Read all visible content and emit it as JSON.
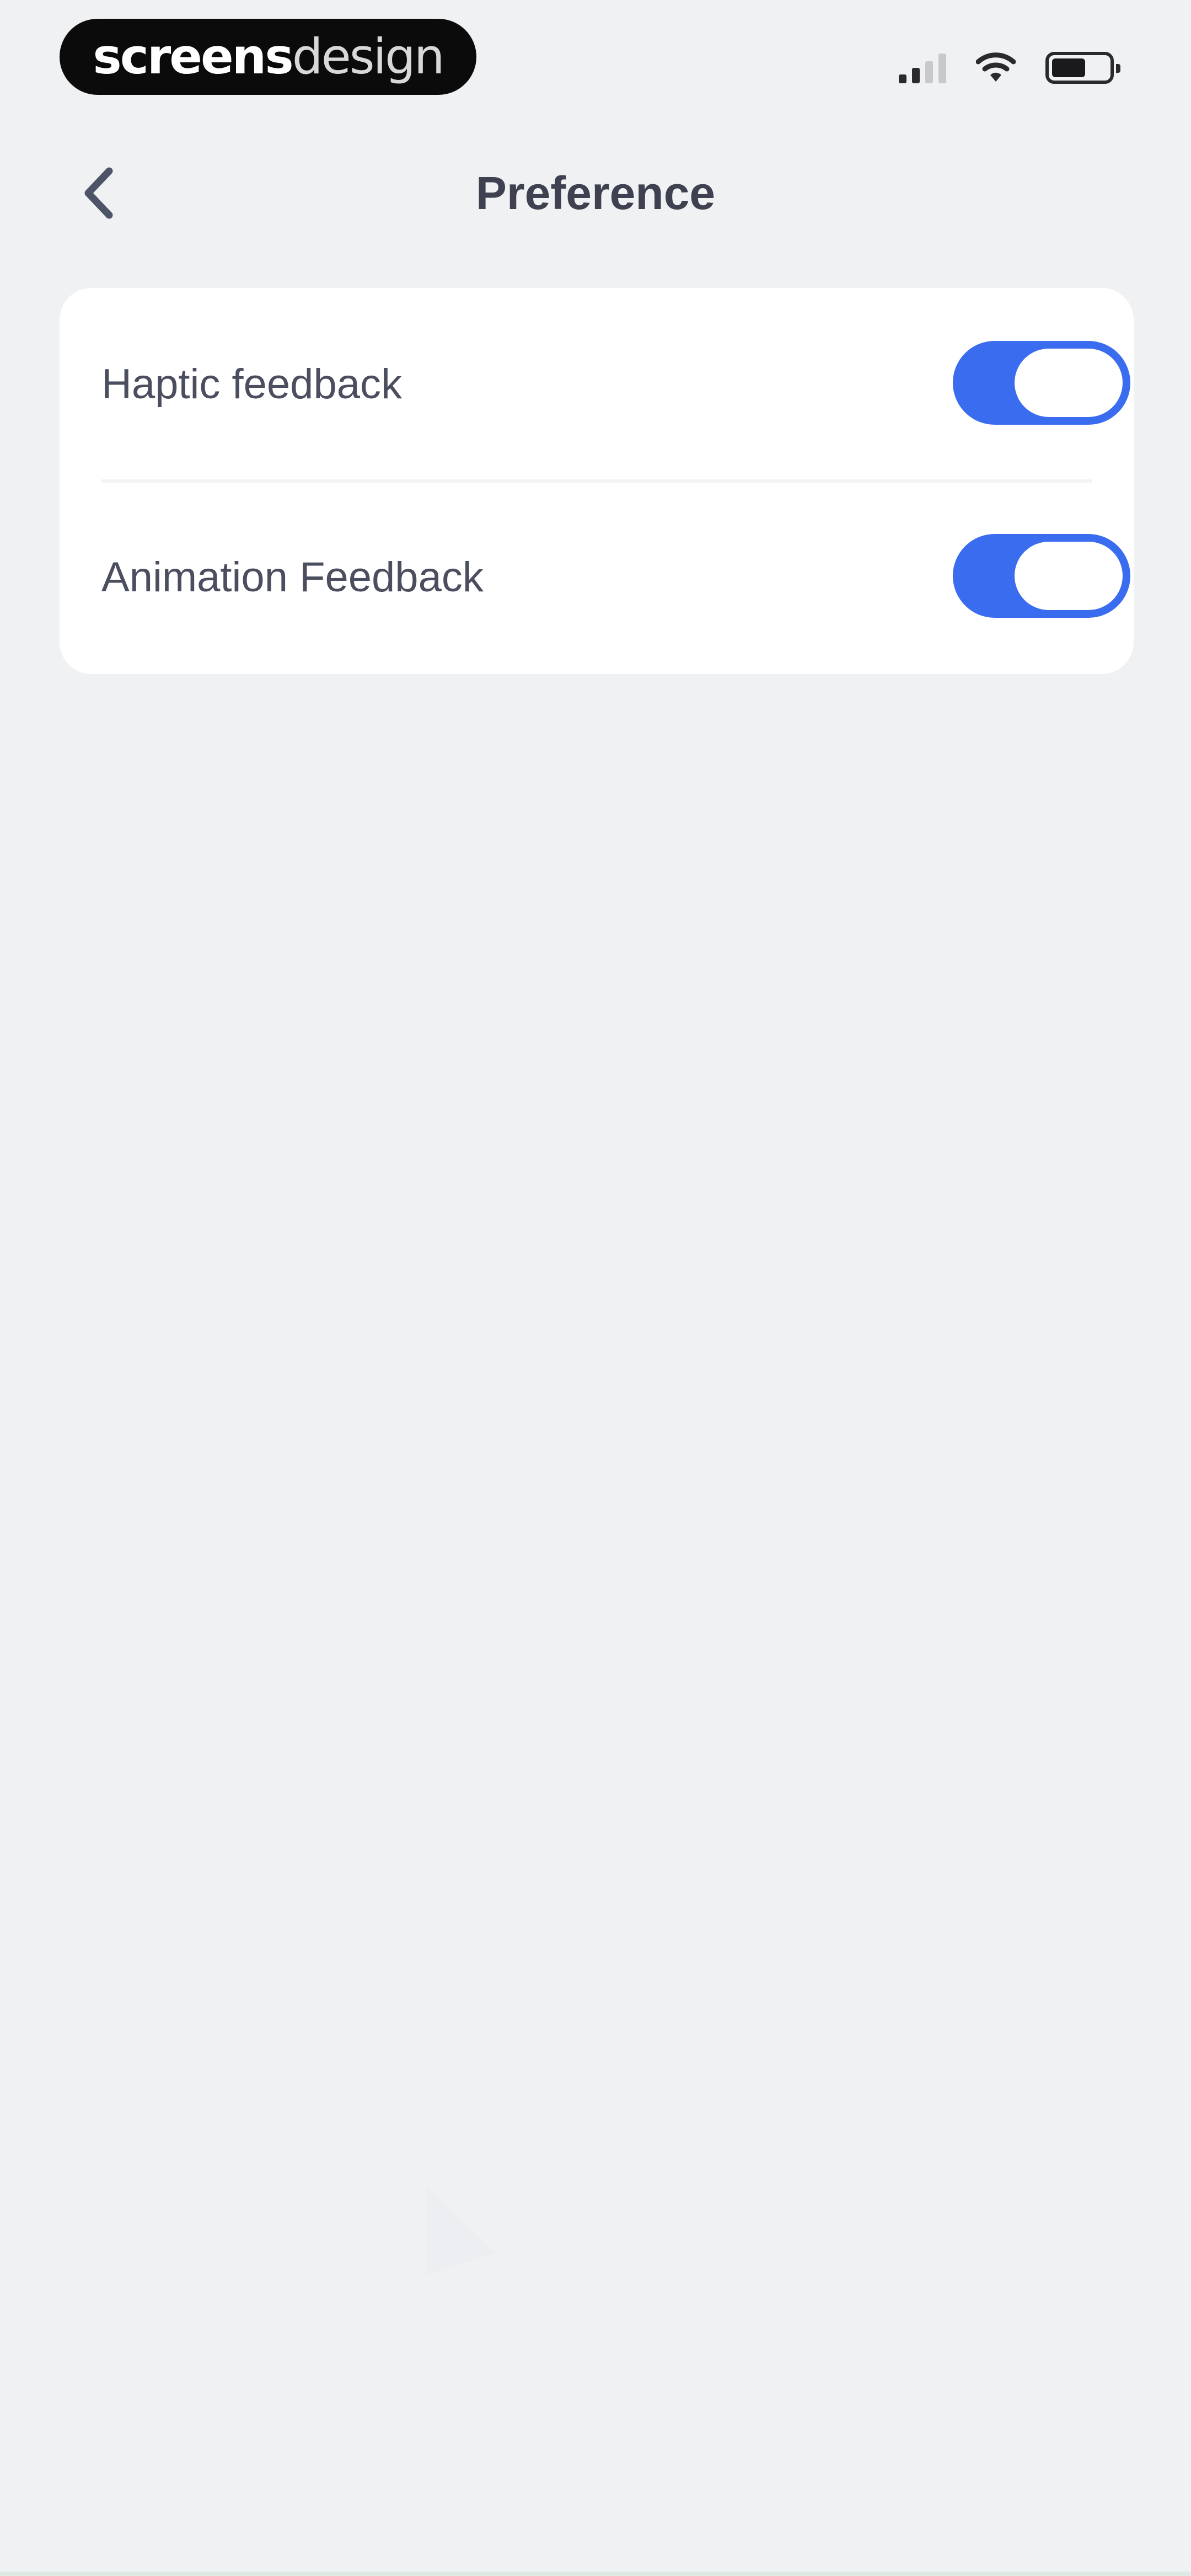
{
  "status_bar": {
    "brand_bold": "screens",
    "brand_light": "design",
    "icons": [
      "cellular-signal-icon",
      "wifi-icon",
      "battery-icon"
    ]
  },
  "nav": {
    "back_icon": "chevron-left-icon",
    "title": "Preference"
  },
  "settings": {
    "items": [
      {
        "label": "Haptic feedback",
        "enabled": true
      },
      {
        "label": "Animation Feedback",
        "enabled": true
      }
    ]
  },
  "colors": {
    "background": "#f0f1f3",
    "card": "#ffffff",
    "accent": "#3a6cf0",
    "title_text": "#3d4150",
    "label_text": "#4a4e5e"
  }
}
